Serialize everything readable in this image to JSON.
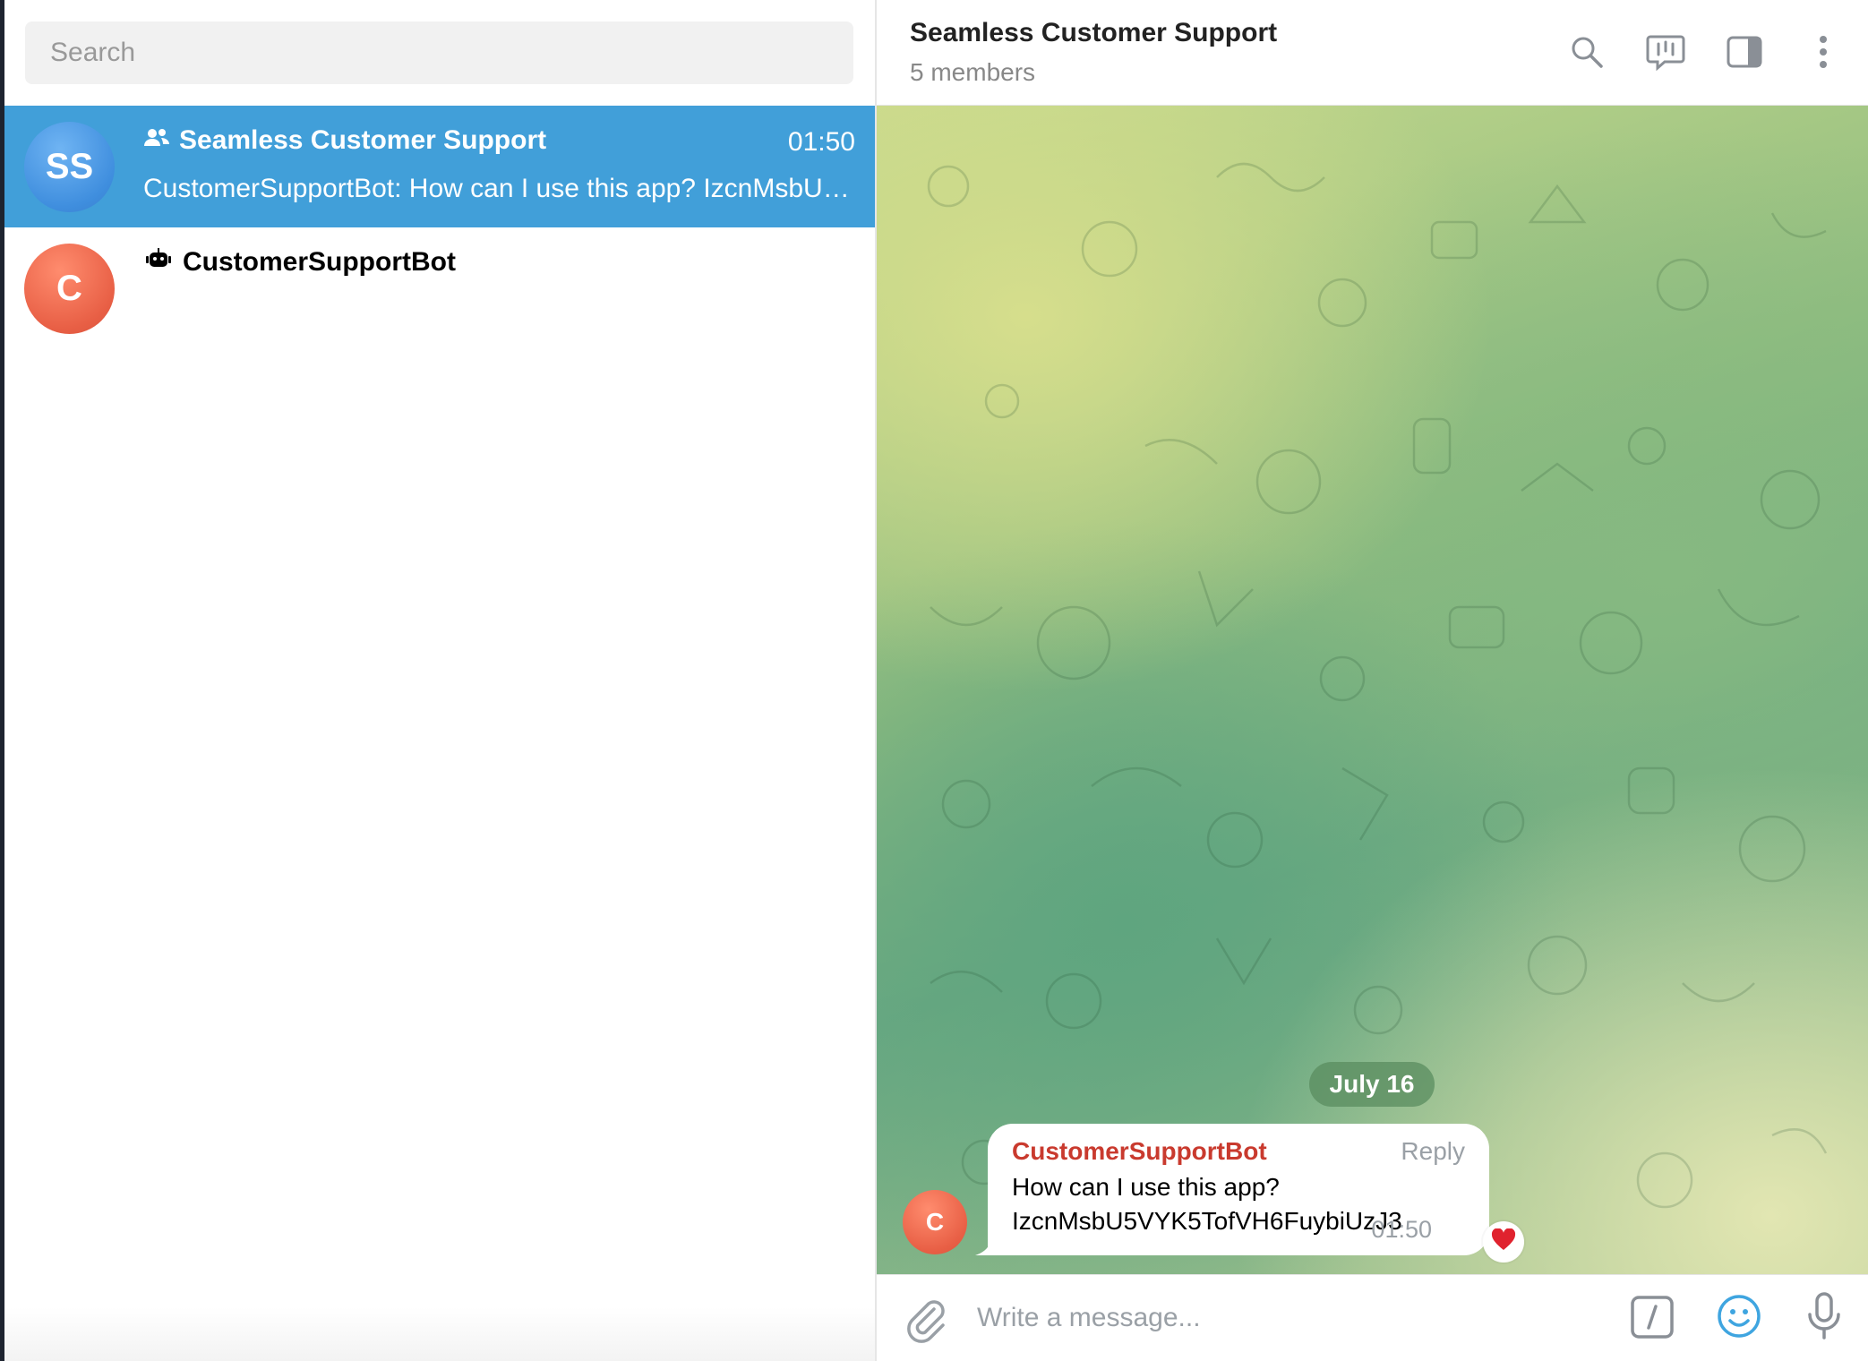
{
  "search": {
    "placeholder": "Search"
  },
  "chats": [
    {
      "initials": "SS",
      "title": "Seamless Customer Support",
      "time": "01:50",
      "preview": "CustomerSupportBot: How can I use this app? IzcnMsbU5VYK5TofVH6FuybiUzJ3",
      "type_icon": "group-icon",
      "active": true
    },
    {
      "initials": "C",
      "title": "CustomerSupportBot",
      "type_icon": "bot-icon",
      "active": false
    }
  ],
  "header": {
    "title": "Seamless Customer Support",
    "subtitle": "5 members",
    "icons": [
      "search-icon",
      "voice-chat-icon",
      "sidebar-toggle-icon",
      "more-icon"
    ]
  },
  "conversation": {
    "date_label": "July 16",
    "messages": [
      {
        "avatar_initial": "C",
        "sender": "CustomerSupportBot",
        "reply_label": "Reply",
        "text_line1": "How can I use this app?",
        "text_line2": "IzcnMsbU5VYK5TofVH6FuybiUzJ3",
        "time": "01:50",
        "reaction": "red-heart"
      }
    ]
  },
  "composer": {
    "placeholder": "Write a message...",
    "icons": [
      "attach-icon",
      "bot-commands-icon",
      "emoji-icon",
      "microphone-icon"
    ]
  },
  "colors": {
    "active_chat": "#419fd9",
    "sender_name": "#c93a2e",
    "accent": "#3fa5e0"
  }
}
